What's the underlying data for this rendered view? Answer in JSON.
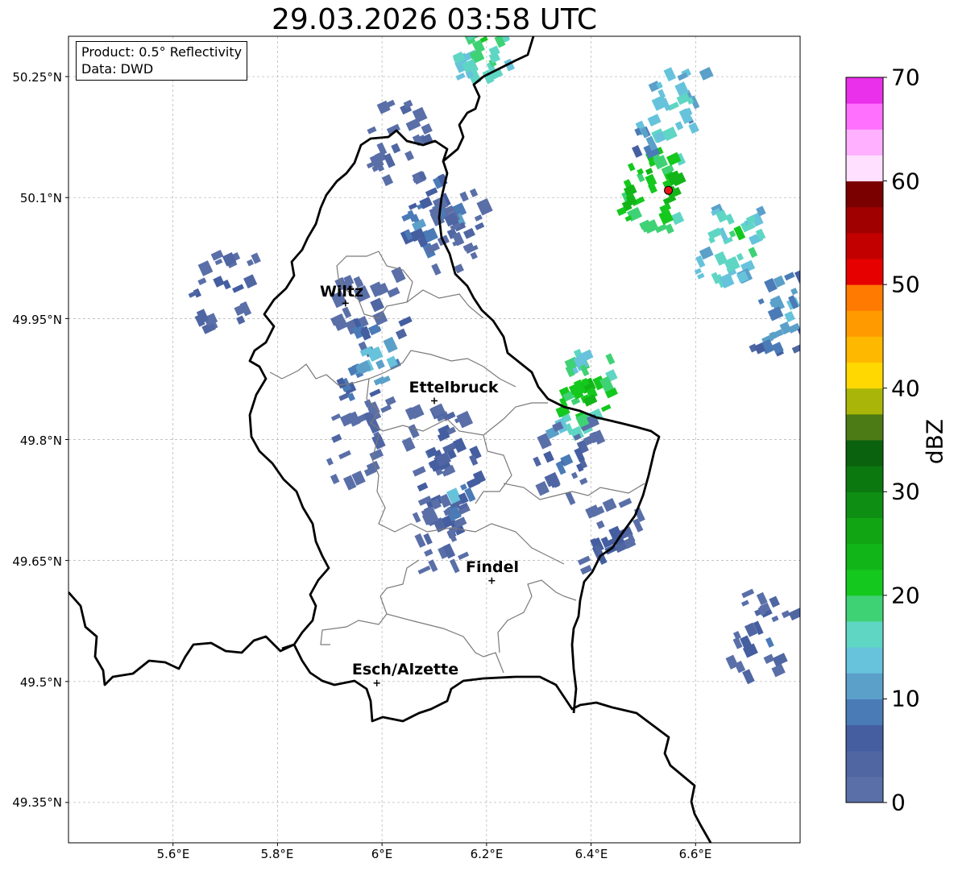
{
  "title": "29.03.2026 03:58 UTC",
  "info": {
    "product": "Product: 0.5° Reflectivity",
    "source": "Data: DWD"
  },
  "axes": {
    "lat_labels": [
      "50.25°N",
      "50.1°N",
      "49.95°N",
      "49.8°N",
      "49.65°N",
      "49.5°N",
      "49.35°N"
    ],
    "lon_labels": [
      "5.6°E",
      "5.8°E",
      "6°E",
      "6.2°E",
      "6.4°E",
      "6.6°E"
    ],
    "lat_values": [
      50.25,
      50.1,
      49.95,
      49.8,
      49.65,
      49.5,
      49.35
    ],
    "lon_values": [
      5.6,
      5.8,
      6.0,
      6.2,
      6.4,
      6.6
    ],
    "lon_range": [
      5.4,
      6.8
    ],
    "lat_range": [
      49.3,
      50.3
    ],
    "grid": true
  },
  "places": [
    {
      "name": "Wiltz",
      "lon": 5.93,
      "lat": 49.969
    },
    {
      "name": "Ettelbruck",
      "lon": 6.1,
      "lat": 49.848
    },
    {
      "name": "Findel",
      "lon": 6.21,
      "lat": 49.625
    },
    {
      "name": "Esch/Alzette",
      "lon": 5.99,
      "lat": 49.498
    }
  ],
  "radar_site": {
    "lon": 6.548,
    "lat": 50.109,
    "color": "#e8141c"
  },
  "colorbar": {
    "label": "dBZ",
    "ticks": [
      "0",
      "10",
      "20",
      "30",
      "40",
      "50",
      "60",
      "70"
    ],
    "min": 0,
    "max": 70,
    "step": 2.5,
    "colors": [
      "#5a6fa8",
      "#4f66a3",
      "#445ea0",
      "#4a7bb7",
      "#5ba0c9",
      "#66c3db",
      "#5fd6c4",
      "#3fd275",
      "#14c81e",
      "#12b517",
      "#11a514",
      "#0e8e12",
      "#0b780f",
      "#0a620e",
      "#4c7a14",
      "#aab509",
      "#fed800",
      "#ffb800",
      "#ff9a00",
      "#ff7a00",
      "#e60000",
      "#c20000",
      "#a00000",
      "#7a0000",
      "#ffe0ff",
      "#ffb0ff",
      "#ff70ff",
      "#ea30ea"
    ]
  },
  "precip_areas": [
    {
      "lon": 6.02,
      "lat": 50.17,
      "dbz": 6
    },
    {
      "lon": 6.09,
      "lat": 50.08,
      "dbz": 12
    },
    {
      "lon": 6.13,
      "lat": 50.06,
      "dbz": 5
    },
    {
      "lon": 5.68,
      "lat": 49.98,
      "dbz": 8
    },
    {
      "lon": 5.95,
      "lat": 49.96,
      "dbz": 5
    },
    {
      "lon": 5.97,
      "lat": 49.9,
      "dbz": 14
    },
    {
      "lon": 5.94,
      "lat": 49.8,
      "dbz": 6
    },
    {
      "lon": 6.08,
      "lat": 49.79,
      "dbz": 8
    },
    {
      "lon": 6.12,
      "lat": 49.74,
      "dbz": 12
    },
    {
      "lon": 6.1,
      "lat": 49.68,
      "dbz": 6
    },
    {
      "lon": 6.38,
      "lat": 49.86,
      "dbz": 24
    },
    {
      "lon": 6.34,
      "lat": 49.78,
      "dbz": 7
    },
    {
      "lon": 6.51,
      "lat": 50.11,
      "dbz": 26
    },
    {
      "lon": 6.54,
      "lat": 50.21,
      "dbz": 18
    },
    {
      "lon": 6.66,
      "lat": 50.05,
      "dbz": 20
    },
    {
      "lon": 6.76,
      "lat": 49.96,
      "dbz": 14
    },
    {
      "lon": 6.43,
      "lat": 49.68,
      "dbz": 6
    },
    {
      "lon": 6.72,
      "lat": 49.56,
      "dbz": 8
    },
    {
      "lon": 6.19,
      "lat": 50.29,
      "dbz": 20
    }
  ]
}
